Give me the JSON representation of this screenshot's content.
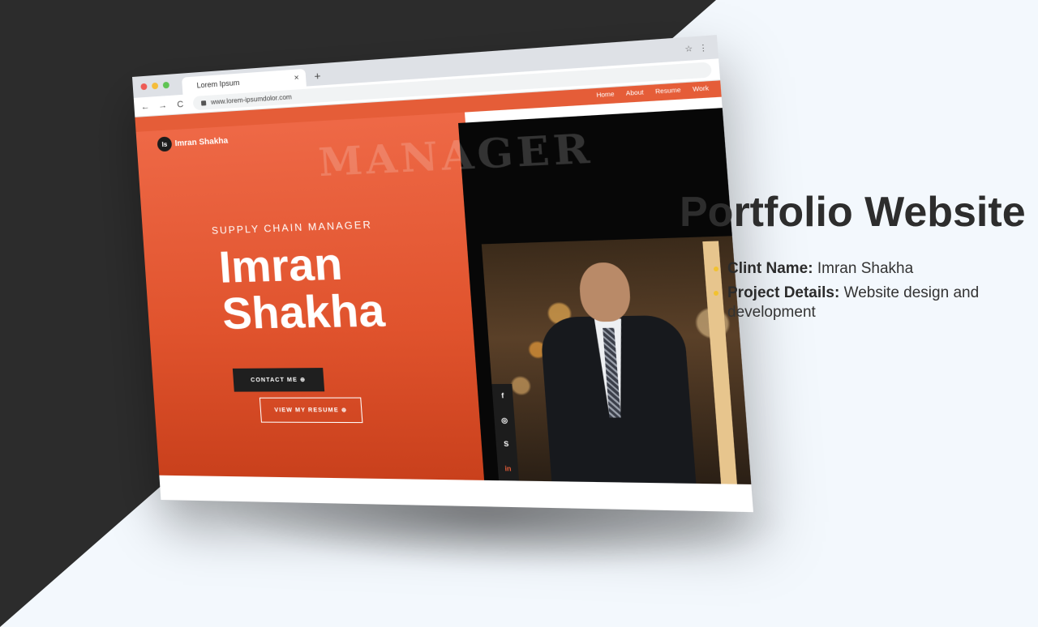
{
  "browser": {
    "tab_title": "Lorem Ipsum",
    "tab_close": "×",
    "new_tab": "+",
    "url": "www.lorem-ipsumdolor.com",
    "back": "←",
    "forward": "→",
    "reload": "C",
    "star": "☆",
    "menu": "⋮"
  },
  "site": {
    "logo_badge": "Is",
    "logo_text": "Imran Shakha",
    "nav": [
      "Home",
      "About",
      "Resume",
      "Work"
    ],
    "watermark": "MANAGER",
    "subtitle": "SUPPLY CHAIN MANAGER",
    "name_line1": "Imran",
    "name_line2": "Shakha",
    "contact_button": "CONTACT ME ⊕",
    "resume_button": "VIEW MY RESUME ⊕",
    "social": [
      "f",
      "◎",
      "S",
      "in"
    ]
  },
  "panel": {
    "title": "Portfolio Website",
    "client_label": "Clint Name:",
    "client_value": " Imran Shakha",
    "details_label": "Project Details:",
    "details_value": " Website design and development"
  },
  "colors": {
    "accent": "#e55d38",
    "dark": "#2c2c2c",
    "bullet": "#f2c230"
  }
}
